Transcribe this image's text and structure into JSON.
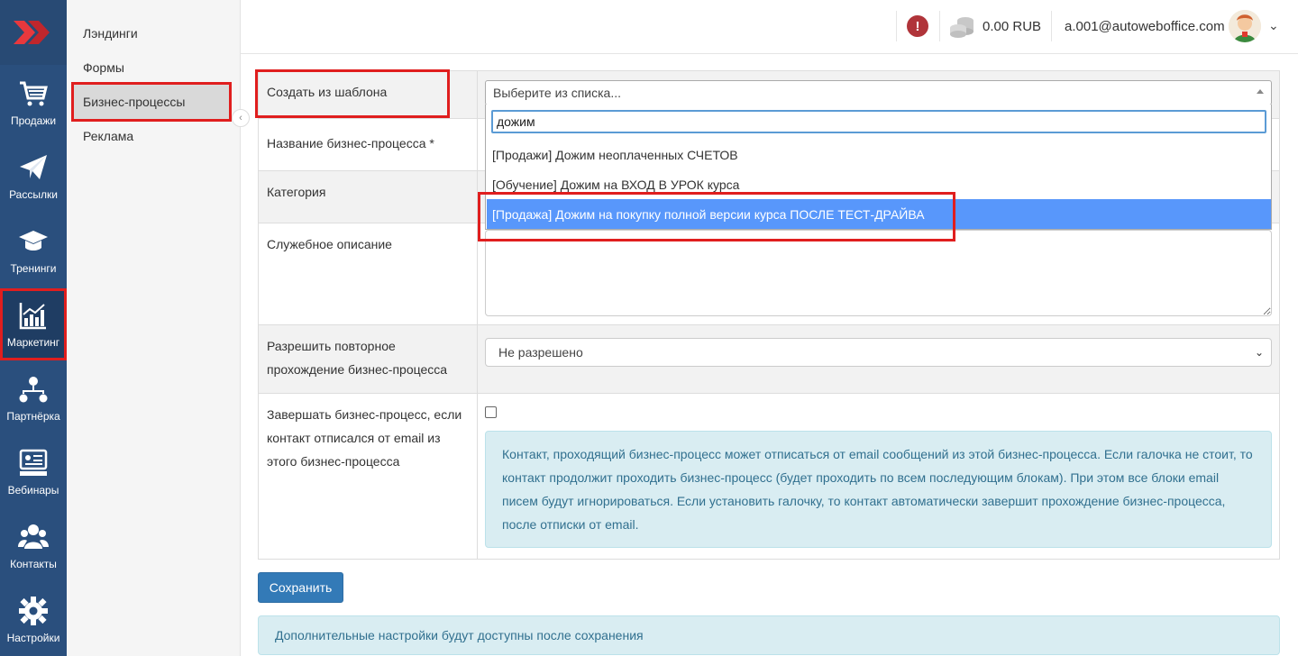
{
  "rail": {
    "items": [
      {
        "label": "Продажи"
      },
      {
        "label": "Рассылки"
      },
      {
        "label": "Тренинги"
      },
      {
        "label": "Маркетинг"
      },
      {
        "label": "Партнёрка"
      },
      {
        "label": "Вебинары"
      },
      {
        "label": "Контакты"
      },
      {
        "label": "Настройки"
      }
    ]
  },
  "subnav": {
    "items": [
      {
        "label": "Лэндинги"
      },
      {
        "label": "Формы"
      },
      {
        "label": "Бизнес-процессы"
      },
      {
        "label": "Реклама"
      }
    ]
  },
  "topbar": {
    "alert": "!",
    "balance": "0.00 RUB",
    "email": "a.001@autoweboffice.com"
  },
  "form": {
    "template": {
      "label": "Создать из шаблона",
      "placeholder": "Выберите из списка..."
    },
    "name": {
      "label": "Название бизнес-процесса *"
    },
    "category": {
      "label": "Категория"
    },
    "description": {
      "label": "Служебное описание"
    },
    "repeat": {
      "label": "Разрешить повторное прохождение бизнес-процесса",
      "value": "Не разрешено"
    },
    "finish": {
      "label": "Завершать бизнес-процесс, если контакт отписался от email из этого бизнес-процесса",
      "info": "Контакт, проходящий бизнес-процесс может отписаться от email сообщений из этой бизнес-процесса. Если галочка не стоит, то контакт продолжит проходить бизнес-процесс (будет проходить по всем последующим блокам). При этом все блоки email писем будут игнорироваться. Если установить галочку, то контакт автоматически завершит прохождение бизнес-процесса, после отписки от email."
    }
  },
  "dropdown": {
    "search_value": "дожим",
    "options": [
      {
        "label": "[Продажи] Дожим неоплаченных СЧЕТОВ"
      },
      {
        "label": "[Обучение] Дожим на ВХОД В УРОК курса"
      },
      {
        "label": "[Продажа] Дожим на покупку полной версии курса ПОСЛЕ ТЕСТ-ДРАЙВА"
      }
    ]
  },
  "actions": {
    "save_label": "Сохранить"
  },
  "footer": {
    "info": "Дополнительные настройки будут доступны после сохранения"
  },
  "colors": {
    "rail": "#2a4f7d",
    "highlight": "#5897fb",
    "annotation": "#e01e1e",
    "primary": "#337ab7"
  }
}
